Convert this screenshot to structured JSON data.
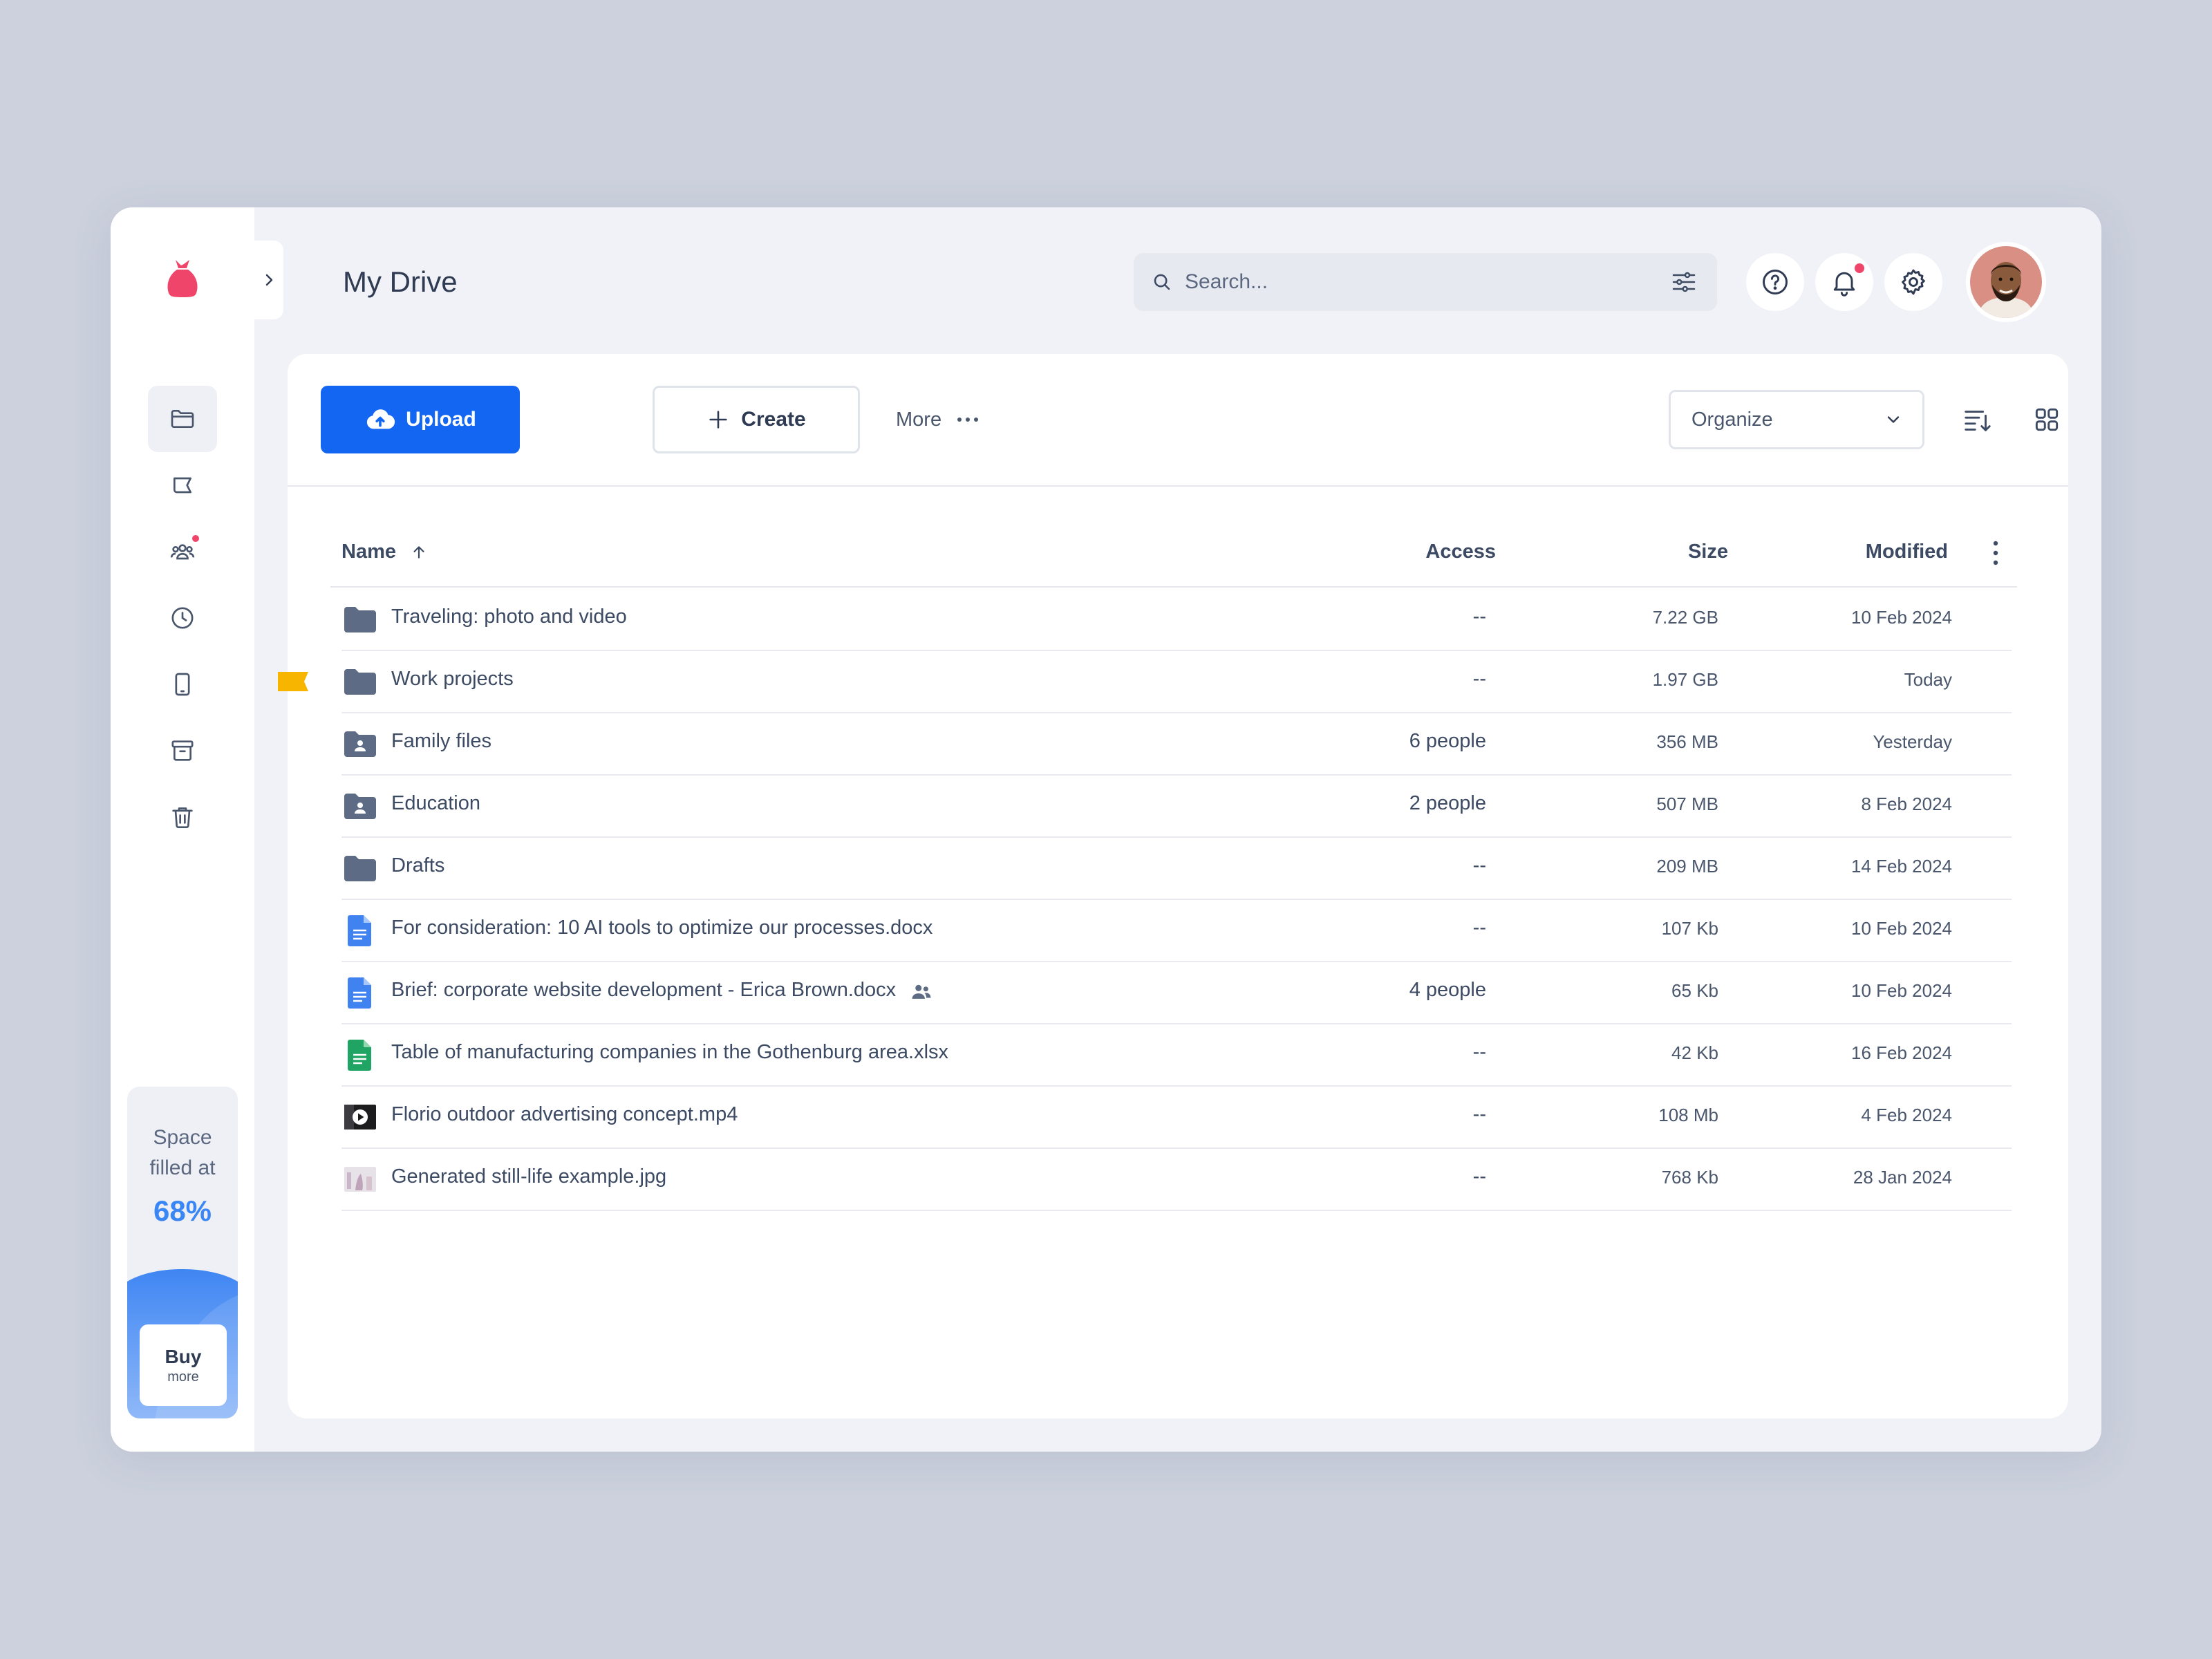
{
  "header": {
    "title": "My Drive",
    "search_placeholder": "Search..."
  },
  "sidebar": {
    "items": [
      {
        "name": "files",
        "icon": "folder-icon",
        "active": true
      },
      {
        "name": "flagged",
        "icon": "flag-icon"
      },
      {
        "name": "shared",
        "icon": "people-icon",
        "badge": true
      },
      {
        "name": "recent",
        "icon": "clock-icon"
      },
      {
        "name": "devices",
        "icon": "phone-icon"
      },
      {
        "name": "archive",
        "icon": "archive-icon"
      },
      {
        "name": "trash",
        "icon": "trash-icon"
      }
    ],
    "storage": {
      "label_line1": "Space",
      "label_line2": "filled at",
      "percent": "68%",
      "buy_label": "Buy",
      "buy_sub": "more"
    }
  },
  "toolbar": {
    "upload_label": "Upload",
    "create_label": "Create",
    "more_label": "More",
    "organize_label": "Organize"
  },
  "table": {
    "columns": {
      "name": "Name",
      "access": "Access",
      "size": "Size",
      "modified": "Modified"
    },
    "rows": [
      {
        "name": "Traveling: photo and video",
        "type": "folder",
        "access": "--",
        "size": "7.22 GB",
        "modified": "10 Feb 2024"
      },
      {
        "name": "Work projects",
        "type": "folder",
        "access": "--",
        "size": "1.97 GB",
        "modified": "Today",
        "flagged": true
      },
      {
        "name": "Family files",
        "type": "shared-folder",
        "access": "6 people",
        "size": "356 MB",
        "modified": "Yesterday"
      },
      {
        "name": "Education",
        "type": "shared-folder",
        "access": "2 people",
        "size": "507 MB",
        "modified": "8 Feb 2024"
      },
      {
        "name": "Drafts",
        "type": "folder",
        "access": "--",
        "size": "209 MB",
        "modified": "14 Feb 2024"
      },
      {
        "name": "For consideration: 10 AI tools to optimize our processes.docx",
        "type": "doc",
        "access": "--",
        "size": "107 Kb",
        "modified": "10 Feb 2024"
      },
      {
        "name": "Brief: corporate website development - Erica Brown.docx",
        "type": "doc",
        "access": "4 people",
        "size": "65 Kb",
        "modified": "10 Feb 2024",
        "shared": true
      },
      {
        "name": "Table of manufacturing companies in the Gothenburg area.xlsx",
        "type": "sheet",
        "access": "--",
        "size": "42 Kb",
        "modified": "16 Feb 2024"
      },
      {
        "name": "Florio outdoor advertising concept.mp4",
        "type": "video",
        "access": "--",
        "size": "108 Mb",
        "modified": "4 Feb 2024"
      },
      {
        "name": "Generated still-life example.jpg",
        "type": "image",
        "access": "--",
        "size": "768 Kb",
        "modified": "28 Jan 2024"
      }
    ]
  },
  "colors": {
    "accent": "#1266f1",
    "brand": "#f0456b",
    "flag": "#f7b500",
    "folder": "#5d6b84",
    "doc": "#3f82f0",
    "sheet": "#1fa463"
  }
}
